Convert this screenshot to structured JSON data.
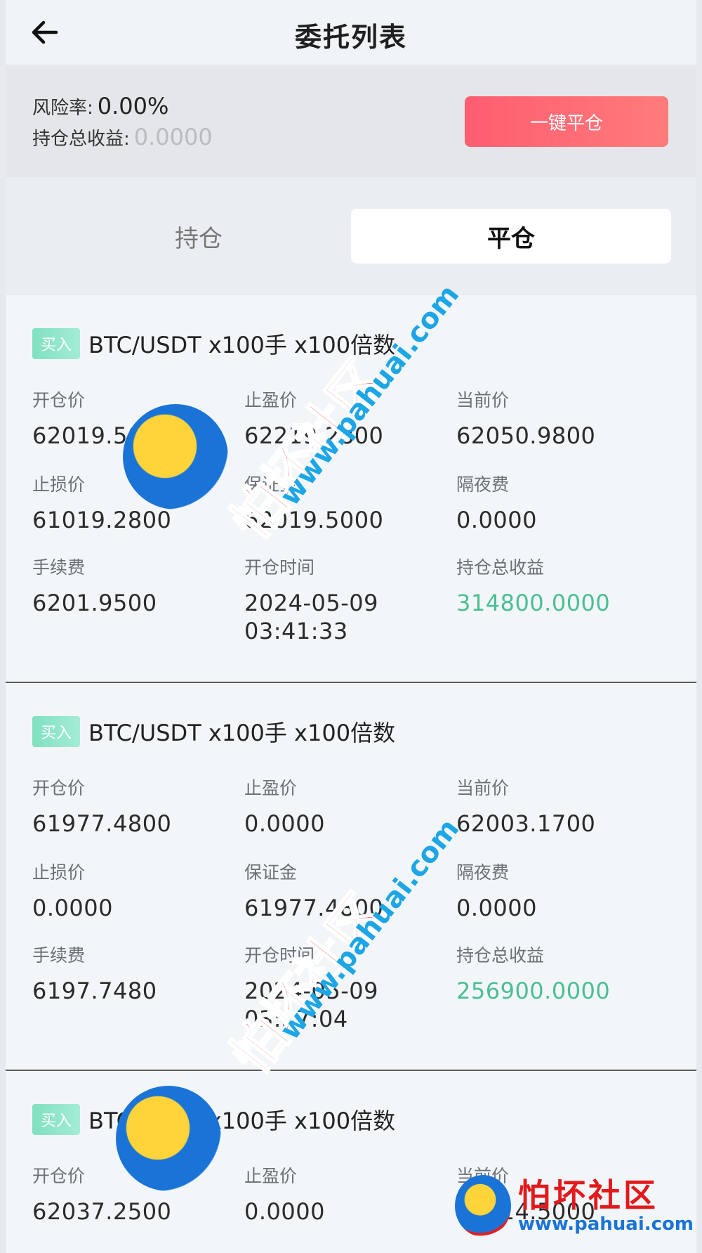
{
  "header": {
    "title": "委托列表"
  },
  "summary": {
    "risk_label": "风险率:",
    "risk_value": "0.00%",
    "profit_label": "持仓总收益:",
    "profit_value": "0.0000",
    "close_all_label": "一键平仓"
  },
  "tabs": [
    {
      "label": "持仓",
      "active": false
    },
    {
      "label": "平仓",
      "active": true
    }
  ],
  "labels": {
    "open_price": "开仓价",
    "take_profit": "止盈价",
    "current_price": "当前价",
    "stop_loss": "止损价",
    "margin": "保证金",
    "overnight_fee": "隔夜费",
    "fee": "手续费",
    "open_time": "开仓时间",
    "total_profit": "持仓总收益"
  },
  "orders": [
    {
      "side": "买入",
      "title": "BTC/USDT x100手 x100倍数",
      "open_price": "62019.5000",
      "take_profit": "62219.2800",
      "current_price": "62050.9800",
      "stop_loss": "61019.2800",
      "margin": "62019.5000",
      "overnight_fee": "0.0000",
      "fee": "6201.9500",
      "open_date": "2024-05-09",
      "open_clock": "03:41:33",
      "total_profit": "314800.0000"
    },
    {
      "side": "买入",
      "title": "BTC/USDT x100手 x100倍数",
      "open_price": "61977.4800",
      "take_profit": "0.0000",
      "current_price": "62003.1700",
      "stop_loss": "0.0000",
      "margin": "61977.4800",
      "overnight_fee": "0.0000",
      "fee": "6197.7480",
      "open_date": "2024-05-09",
      "open_clock": "03:37:04",
      "total_profit": "256900.0000"
    },
    {
      "side": "买入",
      "title": "BTC/USDT x100手 x100倍数",
      "open_price": "62037.2500",
      "take_profit": "0.0000",
      "current_price": "62114.5000"
    }
  ],
  "watermark": {
    "text": "怕坏社区",
    "url": "www.pahuai.com"
  },
  "colors": {
    "accent_red": "#ff5d70",
    "profit_green": "#4bbf93",
    "badge_green": "#7fe0c0"
  }
}
